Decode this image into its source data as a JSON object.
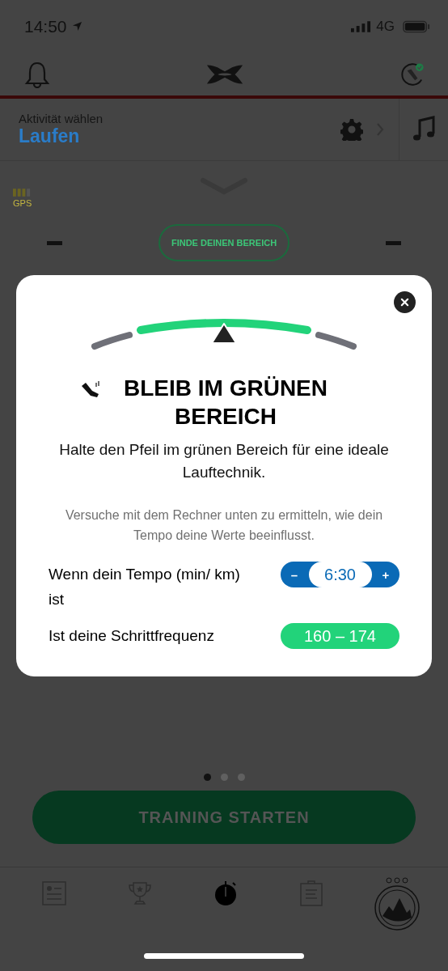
{
  "status_bar": {
    "time": "14:50",
    "network": "4G"
  },
  "activity": {
    "label": "Aktivität wählen",
    "value": "Laufen"
  },
  "gps": {
    "label": "GPS"
  },
  "find_button": {
    "label": "FINDE DEINEN BEREICH"
  },
  "modal": {
    "title": "BLEIB IM GRÜNEN BEREICH",
    "body": "Halte den Pfeil im grünen Bereich für eine ideale Lauftechnik.",
    "hint": "Versuche mit dem Rechner unten zu ermitteln, wie dein Tempo deine Werte beeinflusst.",
    "rows": [
      {
        "kind": "stepper",
        "label": "Wenn dein Tempo (min/ km) ist",
        "minus": "–",
        "value": "6:30",
        "plus": "+"
      },
      {
        "kind": "range",
        "label": "Ist deine Schrittfrequenz",
        "value": "160 – 174"
      }
    ]
  },
  "page_dots": [
    {
      "selected": true
    },
    {
      "selected": false
    },
    {
      "selected": false
    }
  ],
  "start_button": {
    "label": "TRAINING STARTEN"
  },
  "tab_bar": [
    {
      "selected": false
    },
    {
      "selected": false
    },
    {
      "selected": true
    },
    {
      "selected": false
    },
    {
      "selected": false
    }
  ]
}
